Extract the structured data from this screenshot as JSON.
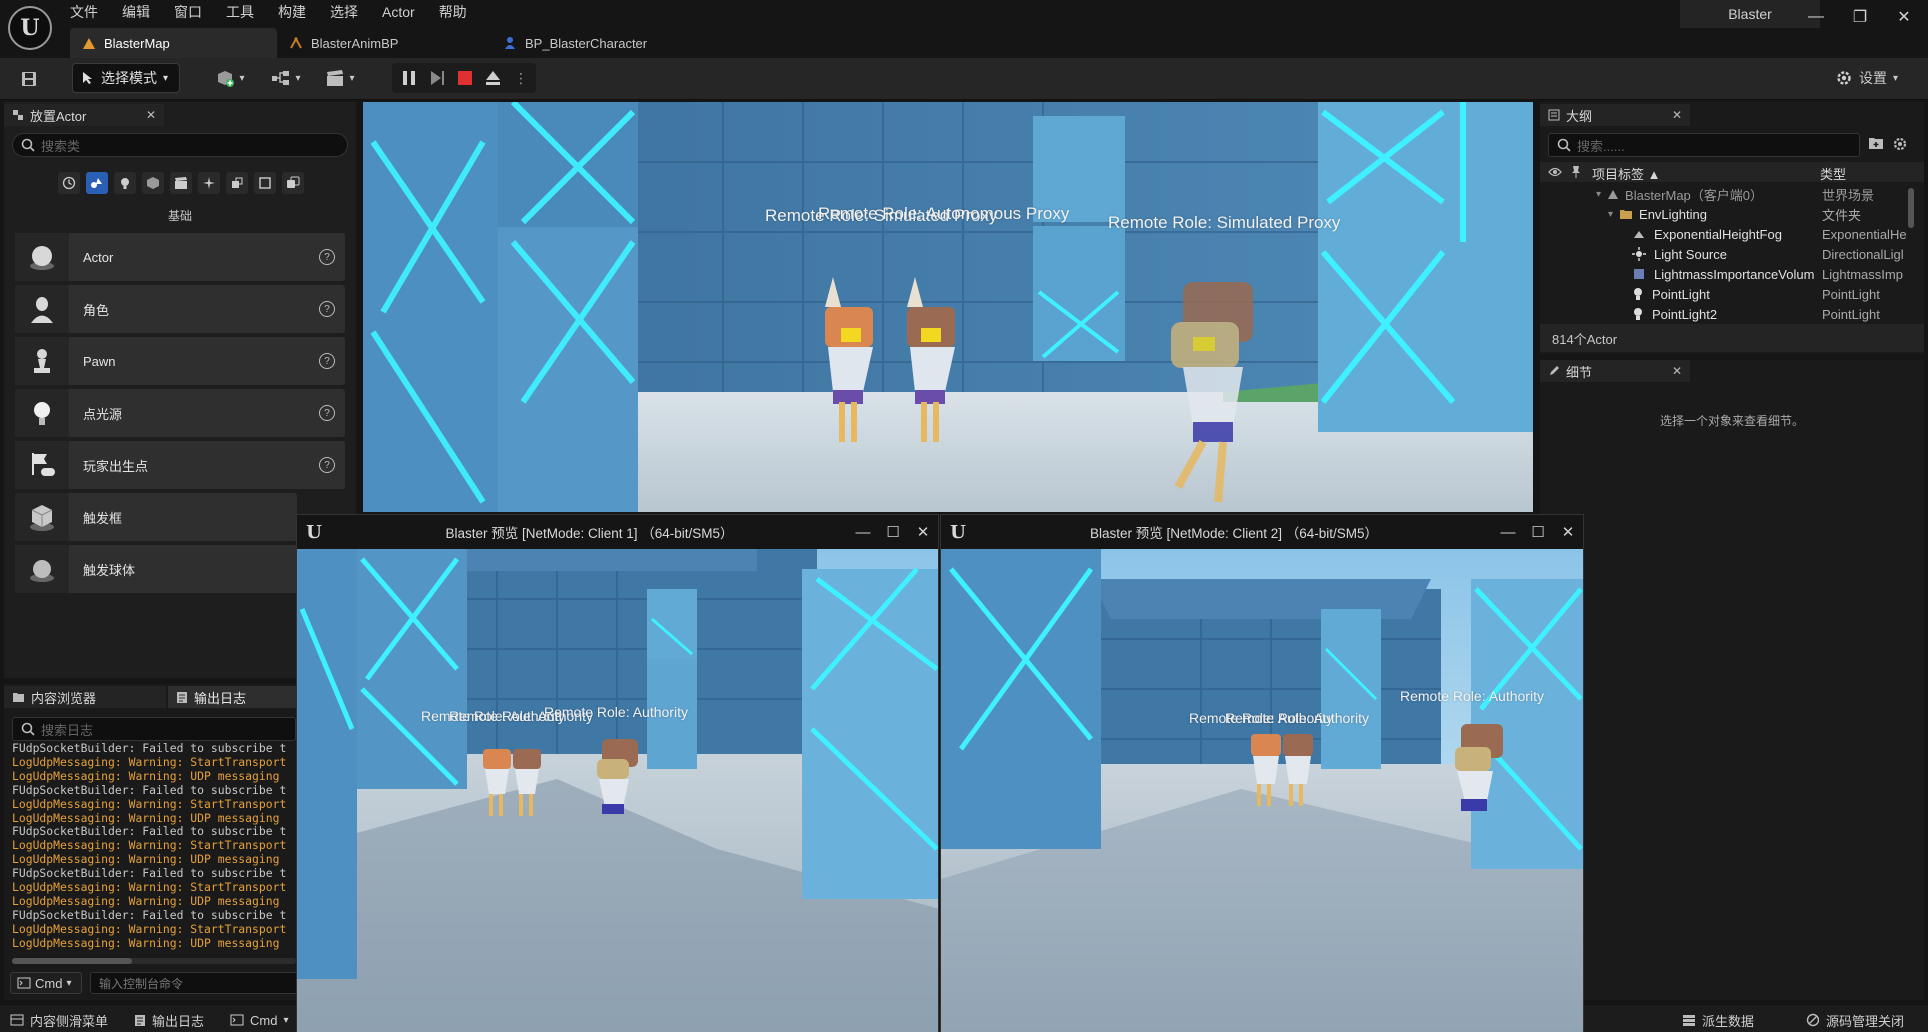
{
  "menu": {
    "items": [
      "文件",
      "编辑",
      "窗口",
      "工具",
      "构建",
      "选择",
      "Actor",
      "帮助"
    ]
  },
  "window": {
    "project_name": "Blaster",
    "minimize": "—",
    "restore": "❐",
    "close": "✕"
  },
  "doc_tabs": [
    {
      "label": "BlasterMap",
      "active": true
    },
    {
      "label": "BlasterAnimBP",
      "active": false
    },
    {
      "label": "BP_BlasterCharacter",
      "active": false
    }
  ],
  "toolbar": {
    "mode_label": "选择模式",
    "settings_label": "设置"
  },
  "place_actors": {
    "title": "放置Actor",
    "search_placeholder": "搜索类",
    "category_label": "基础",
    "items": [
      {
        "label": "Actor"
      },
      {
        "label": "角色"
      },
      {
        "label": "Pawn"
      },
      {
        "label": "点光源"
      },
      {
        "label": "玩家出生点"
      },
      {
        "label": "触发框"
      },
      {
        "label": "触发球体"
      }
    ]
  },
  "bottom_tabs": {
    "content_browser": "内容浏览器",
    "output_log": "输出日志",
    "search_placeholder": "搜索日志"
  },
  "log": {
    "lines": [
      {
        "text": "FUdpSocketBuilder: Failed to subscribe t",
        "level": "plain"
      },
      {
        "text": "LogUdpMessaging: Warning: StartTransport",
        "level": "warn"
      },
      {
        "text": "LogUdpMessaging: Warning: UDP messaging",
        "level": "warn"
      },
      {
        "text": "FUdpSocketBuilder: Failed to subscribe t",
        "level": "plain"
      },
      {
        "text": "LogUdpMessaging: Warning: StartTransport",
        "level": "warn"
      },
      {
        "text": "LogUdpMessaging: Warning: UDP messaging",
        "level": "warn"
      },
      {
        "text": "FUdpSocketBuilder: Failed to subscribe t",
        "level": "plain"
      },
      {
        "text": "LogUdpMessaging: Warning: StartTransport",
        "level": "warn"
      },
      {
        "text": "LogUdpMessaging: Warning: UDP messaging",
        "level": "warn"
      },
      {
        "text": "FUdpSocketBuilder: Failed to subscribe t",
        "level": "plain"
      },
      {
        "text": "LogUdpMessaging: Warning: StartTransport",
        "level": "warn"
      },
      {
        "text": "LogUdpMessaging: Warning: UDP messaging",
        "level": "warn"
      },
      {
        "text": "FUdpSocketBuilder: Failed to subscribe t",
        "level": "plain"
      },
      {
        "text": "LogUdpMessaging: Warning: StartTransport",
        "level": "warn"
      },
      {
        "text": "LogUdpMessaging: Warning: UDP messaging",
        "level": "warn"
      }
    ],
    "cmd_label": "Cmd",
    "console_placeholder": "输入控制台命令"
  },
  "statusbar": {
    "drawer": "内容侧滑菜单",
    "output_log": "输出日志",
    "cmd": "Cmd",
    "derived_data": "派生数据",
    "source_control": "源码管理关闭"
  },
  "viewport": {
    "labels": {
      "left_overlap_a": "Remote Role: Simulated Proxy",
      "left_overlap_b": "Remote Role: Autonomous Proxy",
      "right": "Remote Role: Simulated Proxy"
    }
  },
  "outliner": {
    "title": "大纲",
    "search_placeholder": "搜索......",
    "col_label": "项目标签",
    "col_type": "类型",
    "rows": [
      {
        "name": "BlasterMap（客户端0）",
        "type": "世界场景"
      },
      {
        "name": "EnvLighting",
        "type": "文件夹"
      },
      {
        "name": "ExponentialHeightFog",
        "type": "ExponentialHe"
      },
      {
        "name": "Light Source",
        "type": "DirectionalLigl"
      },
      {
        "name": "LightmassImportanceVolum",
        "type": "LightmassImp"
      },
      {
        "name": "PointLight",
        "type": "PointLight"
      },
      {
        "name": "PointLight2",
        "type": "PointLight"
      }
    ],
    "count": "814个Actor"
  },
  "details": {
    "title": "细节",
    "empty_msg": "选择一个对象来查看细节。"
  },
  "pie1": {
    "title": "Blaster 预览 [NetMode: Client 1] （64-bit/SM5）",
    "label_overlap_a": "Remote Role: Authority",
    "label_overlap_b": "Remote Role: Authority",
    "label_right": "Remote Role: Authority"
  },
  "pie2": {
    "title": "Blaster 预览 [NetMode: Client 2] （64-bit/SM5）",
    "label_overlap_a": "Remote Role: Authority",
    "label_overlap_b": "Remote Role: Authority",
    "label_right": "Remote Role: Authority"
  },
  "colors": {
    "accent_blue": "#2a5fb5",
    "stop_red": "#e03030",
    "warning_orange": "#e6a03a",
    "neon_cyan": "#3ff0ff"
  }
}
